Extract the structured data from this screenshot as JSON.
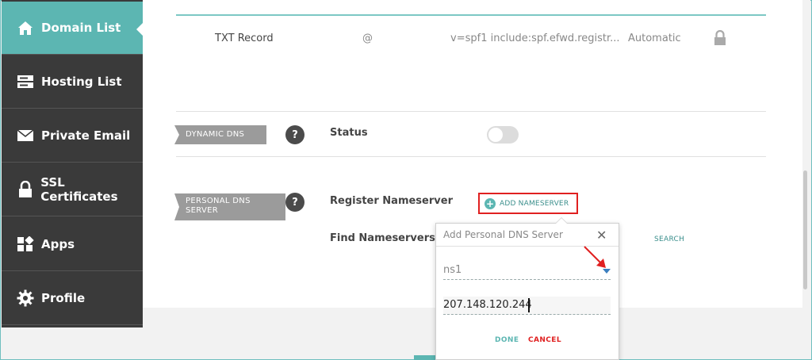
{
  "sidebar": {
    "items": [
      {
        "label": "Domain List",
        "icon": "home-icon",
        "active": true
      },
      {
        "label": "Hosting List",
        "icon": "server-icon",
        "active": false
      },
      {
        "label": "Private Email",
        "icon": "envelope-icon",
        "active": false
      },
      {
        "label": "SSL Certificates",
        "icon": "lock-icon",
        "active": false
      },
      {
        "label": "Apps",
        "icon": "apps-icon",
        "active": false
      },
      {
        "label": "Profile",
        "icon": "gear-icon",
        "active": false
      }
    ]
  },
  "dns_record": {
    "type": "TXT Record",
    "host": "@",
    "value": "v=spf1 include:spf.efwd.registr...",
    "ttl": "Automatic",
    "icon": "lock-icon"
  },
  "dynamic_dns": {
    "tag": "DYNAMIC DNS",
    "help": "?",
    "status_label": "Status",
    "enabled": false
  },
  "personal_dns": {
    "tag_line1": "PERSONAL DNS",
    "tag_line2": "SERVER",
    "help": "?",
    "register_label": "Register Nameserver",
    "add_button": "ADD NAMESERVER",
    "find_label": "Find Nameservers",
    "search_button": "SEARCH"
  },
  "popup": {
    "title": "Add Personal DNS Server",
    "close": "✕",
    "nameserver_value": "ns1",
    "ip_value": "207.148.120.244",
    "done": "DONE",
    "cancel": "CANCEL"
  },
  "colors": {
    "accent": "#5cb6b2",
    "sidebar": "#3a3a3a",
    "highlight": "#e02020"
  }
}
